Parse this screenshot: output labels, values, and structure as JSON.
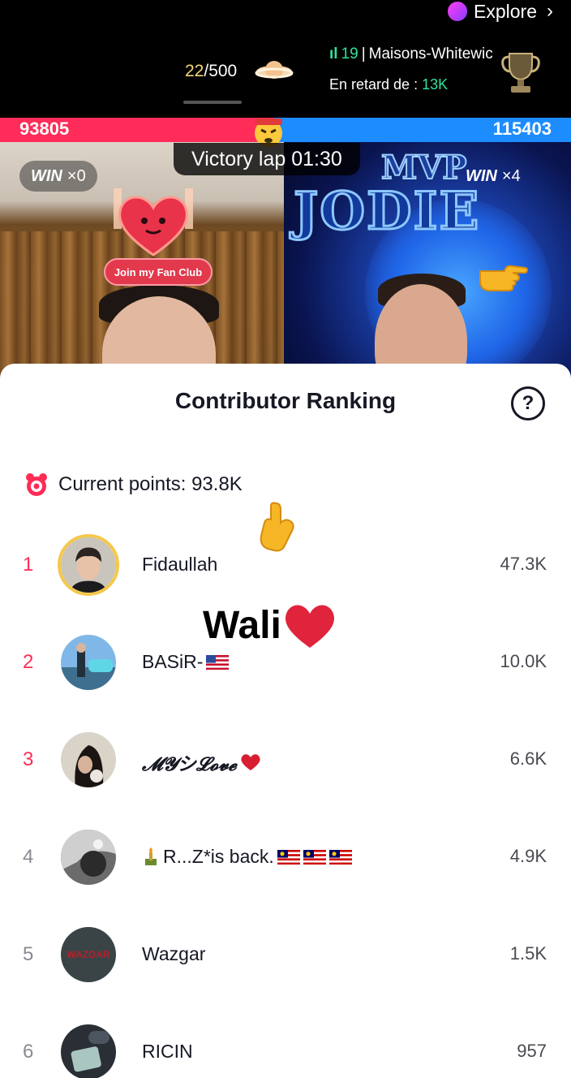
{
  "header": {
    "explore_label": "Explore",
    "goal_current": "22",
    "goal_total": "/500",
    "rank_number": "19",
    "rank_separator": "|",
    "rank_name": "Maisons-Whitewic",
    "late_label": "En retard de : ",
    "late_value": "13K"
  },
  "battle": {
    "score_left": "93805",
    "score_right": "115403",
    "victory_label": "Victory lap 01:30",
    "win_left_label": "WIN",
    "win_left_count": "×0",
    "win_right_label": "WIN",
    "win_right_count": "×4",
    "fan_club_label": "Join my Fan Club",
    "overlay_mvp": "MVP",
    "overlay_name": "JODIE"
  },
  "sheet": {
    "title": "Contributor Ranking",
    "help_symbol": "?",
    "current_points_label": "Current points: 93.8K"
  },
  "contributors": [
    {
      "rank": "1",
      "name": "Fidaullah",
      "score": "47.3K"
    },
    {
      "rank": "2",
      "name": "BASiR-",
      "score": "10.0K"
    },
    {
      "rank": "3",
      "name": "𝓜𝓨シ𝓛𝓸𝓿𝓮",
      "score": "6.6K"
    },
    {
      "rank": "4",
      "name": "R...Z*is back.",
      "score": "4.9K"
    },
    {
      "rank": "5",
      "name": "Wazgar",
      "score": "1.5K"
    },
    {
      "rank": "6",
      "name": "RICIN",
      "score": "957"
    }
  ],
  "avatar_text_5": "WAZGAR",
  "overlay": {
    "text": "Wali"
  },
  "colors": {
    "accent_red": "#fe2c55",
    "battle_blue": "#1d8cff",
    "gold_ring": "#f4c84b",
    "green": "#2fe39a"
  },
  "icons": [
    "explore-dot-icon",
    "chevron-right-icon",
    "planet-icon",
    "signal-bars-icon",
    "trophy-icon",
    "angry-emoji-icon",
    "heart-mascot-icon",
    "pointing-hand-icon",
    "help-icon",
    "alarm-clock-icon",
    "pointing-down-hand-icon",
    "us-flag-icon",
    "malaysia-flag-icon",
    "candle-icon",
    "heart-icon"
  ]
}
